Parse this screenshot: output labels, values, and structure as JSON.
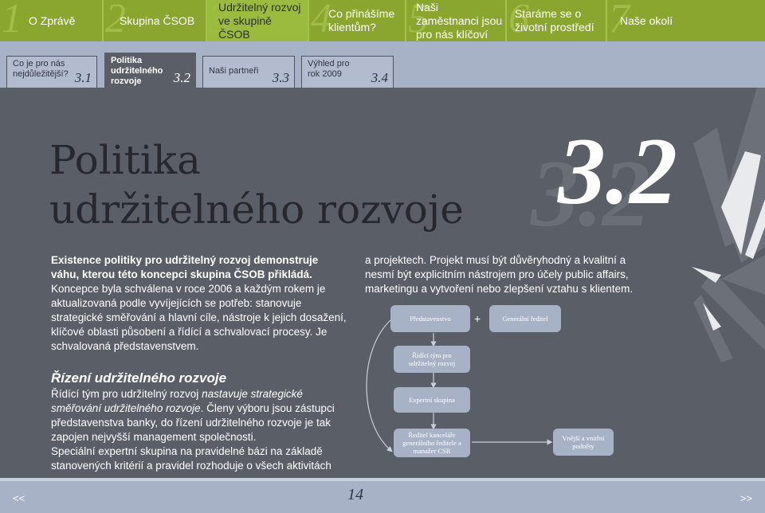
{
  "topnav": [
    {
      "num": "1",
      "label": "O Zprávě"
    },
    {
      "num": "2",
      "label": "Skupina ČSOB"
    },
    {
      "num": "3",
      "label": "Udržitelný rozvoj ve skupině ČSOB"
    },
    {
      "num": "4",
      "label": "Co přinášíme klientům?"
    },
    {
      "num": "5",
      "label": "Naši zaměstnanci jsou pro nás klíčoví"
    },
    {
      "num": "6",
      "label": "Staráme se o životní prostředí"
    },
    {
      "num": "7",
      "label": "Naše okolí"
    }
  ],
  "subnav": [
    {
      "label": "Co je pro nás nejdůležitější?",
      "num": "3.1"
    },
    {
      "label": "Politika udržitelného rozvoje",
      "num": "3.2"
    },
    {
      "label": "Naši partneři",
      "num": "3.3"
    },
    {
      "label": "Výhled pro rok 2009",
      "num": "3.4"
    }
  ],
  "main": {
    "title_line1": "Politika",
    "title_line2": "udržitelného rozvoje",
    "section_number": "3.2",
    "lead": "Existence politiky pro udržitelný rozvoj demonstruje váhu, kterou této koncepci skupina ČSOB přikládá.",
    "para1": " Koncepce byla schválena v roce 2006 a každým rokem je aktualizovaná podle vyvíjejících se potřeb: stanovuje strategické směřování a hlavní cíle, nástroje k jejich dosažení, klíčové oblasti působení a řídící a schvalovací procesy. Je schvalovaná představenstvem.",
    "heading2": "Řízení udržitelného rozvoje",
    "para2_a": "Řídící tým pro udržitelný rozvoj ",
    "para2_em": "nastavuje strategické směřování udržitelného rozvoje",
    "para2_b": ". Členy výboru jsou zástupci představenstva banky, do řízení udržitelného rozvoje je tak zapojen nejvyšší management společnosti.",
    "para3": "Speciální expertní skupina na pravidelné bázi na základě stanovených kritérií a pravidel rozhoduje o všech aktivitách",
    "right_para": "a projektech. Projekt musí být důvěryhodný a kvalitní a nesmí být explicitním nástrojem pro účely public affairs, marketingu a vytvoření nebo zlepšení vztahu s klientem."
  },
  "orgchart": {
    "board": "Představenstvo",
    "plus": "+",
    "ceo": "Generální ředitel",
    "team": "Řídící tým pro udržitelný rozvoj",
    "experts": "Expertní skupina",
    "csr": "Ředitel kanceláře generálního ředitele a manažer CSR",
    "partners": "Vnější a vnitřní podněty"
  },
  "footer": {
    "prev": "<<",
    "page": "14",
    "next": ">>"
  },
  "colors": {
    "nav_green": "#8aa62f",
    "sub_blue": "#a8b2c7",
    "main_bg": "#5a5e66",
    "accent_white": "#ffffff"
  }
}
